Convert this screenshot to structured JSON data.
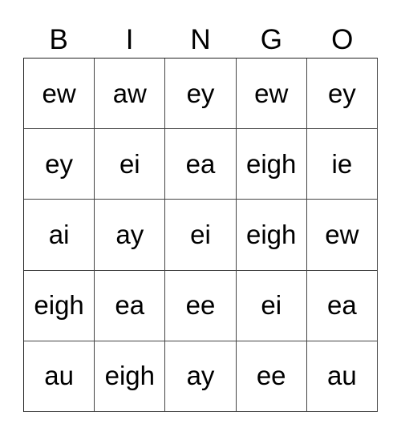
{
  "header": {
    "letters": [
      "B",
      "I",
      "N",
      "G",
      "O"
    ]
  },
  "grid": {
    "rows": [
      [
        "ew",
        "aw",
        "ey",
        "ew",
        "ey"
      ],
      [
        "ey",
        "ei",
        "ea",
        "eigh",
        "ie"
      ],
      [
        "ai",
        "ay",
        "ei",
        "eigh",
        "ew"
      ],
      [
        "eigh",
        "ea",
        "ee",
        "ei",
        "ea"
      ],
      [
        "au",
        "eigh",
        "ay",
        "ee",
        "au"
      ]
    ]
  }
}
